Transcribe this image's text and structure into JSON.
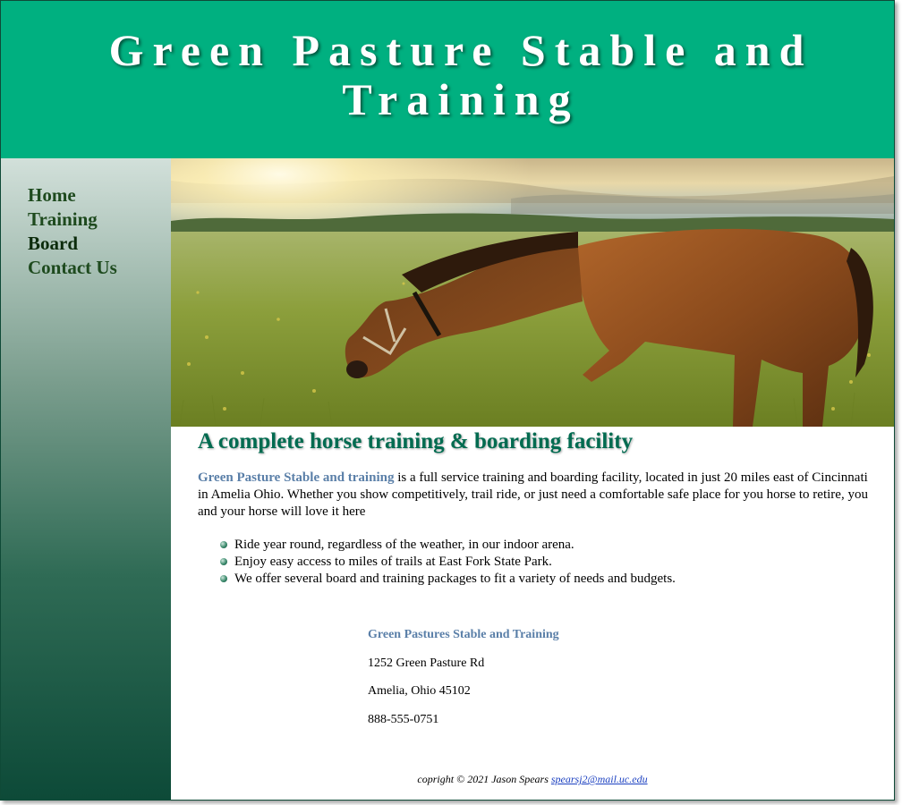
{
  "header": {
    "title": "Green Pasture Stable and Training"
  },
  "nav": {
    "items": [
      {
        "label": "Home"
      },
      {
        "label": "Training"
      },
      {
        "label": "Board"
      },
      {
        "label": "Contact Us"
      }
    ]
  },
  "hero": {
    "alt": "horse grazing in a sunlit pasture"
  },
  "main": {
    "heading": "A complete horse training & boarding facility",
    "intro_brand": "Green Pasture Stable and training",
    "intro_text": " is a full service training and boarding facility, located in just 20 miles east of Cincinnati in Amelia Ohio. Whether you show competitively, trail ride, or just need a comfortable safe place for you horse to retire, you and your horse will love it here",
    "features": [
      "Ride year round, regardless of the weather, in our indoor arena.",
      "Enjoy easy access to miles of trails at East Fork State Park.",
      "We offer several board and training packages to fit a variety of needs and budgets."
    ]
  },
  "address": {
    "name": "Green Pastures Stable and Training",
    "street": "1252 Green Pasture Rd",
    "city": "Amelia, Ohio 45102",
    "phone": "888-555-0751"
  },
  "footer": {
    "copyright": "copright © 2021 Jason Spears ",
    "email": "spearsj2@mail.uc.edu"
  },
  "colors": {
    "banner": "#00b080",
    "heading": "#006b50",
    "brand_text": "#5a7fa8",
    "nav_text": "#1e4a1e"
  }
}
